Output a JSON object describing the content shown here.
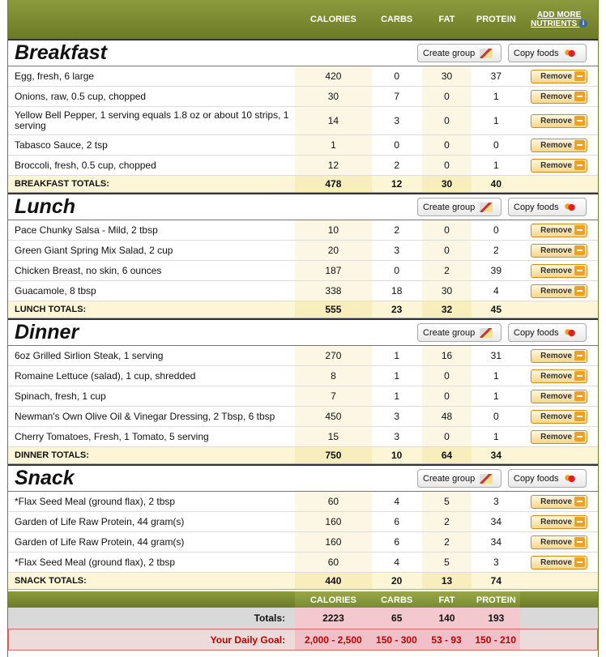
{
  "columns": {
    "calories": "CALORIES",
    "carbs": "CARBS",
    "fat": "FAT",
    "protein": "PROTEIN",
    "add_more_line1": "ADD MORE",
    "add_more_line2": "NUTRIENTS",
    "info_glyph": "i"
  },
  "buttons": {
    "create_group": "Create group",
    "copy_foods": "Copy foods",
    "remove": "Remove"
  },
  "meals": [
    {
      "title": "Breakfast",
      "items": [
        {
          "name": "Egg, fresh, 6 large",
          "calories": "420",
          "carbs": "0",
          "fat": "30",
          "protein": "37"
        },
        {
          "name": "Onions, raw, 0.5 cup, chopped",
          "calories": "30",
          "carbs": "7",
          "fat": "0",
          "protein": "1"
        },
        {
          "name": "Yellow Bell Pepper, 1 serving equals 1.8 oz or about 10 strips, 1 serving",
          "calories": "14",
          "carbs": "3",
          "fat": "0",
          "protein": "1",
          "tall": true
        },
        {
          "name": "Tabasco Sauce, 2 tsp",
          "calories": "1",
          "carbs": "0",
          "fat": "0",
          "protein": "0"
        },
        {
          "name": "Broccoli, fresh, 0.5 cup, chopped",
          "calories": "12",
          "carbs": "2",
          "fat": "0",
          "protein": "1"
        }
      ],
      "totals": {
        "label": "BREAKFAST TOTALS:",
        "calories": "478",
        "carbs": "12",
        "fat": "30",
        "protein": "40"
      }
    },
    {
      "title": "Lunch",
      "items": [
        {
          "name": "Pace Chunky Salsa - Mild, 2 tbsp",
          "calories": "10",
          "carbs": "2",
          "fat": "0",
          "protein": "0"
        },
        {
          "name": "Green Giant Spring Mix Salad, 2 cup",
          "calories": "20",
          "carbs": "3",
          "fat": "0",
          "protein": "2"
        },
        {
          "name": "Chicken Breast, no skin, 6 ounces",
          "calories": "187",
          "carbs": "0",
          "fat": "2",
          "protein": "39"
        },
        {
          "name": "Guacamole, 8 tbsp",
          "calories": "338",
          "carbs": "18",
          "fat": "30",
          "protein": "4"
        }
      ],
      "totals": {
        "label": "LUNCH TOTALS:",
        "calories": "555",
        "carbs": "23",
        "fat": "32",
        "protein": "45"
      }
    },
    {
      "title": "Dinner",
      "items": [
        {
          "name": "6oz Grilled Sirlion Steak, 1 serving",
          "calories": "270",
          "carbs": "1",
          "fat": "16",
          "protein": "31"
        },
        {
          "name": "Romaine Lettuce (salad), 1 cup, shredded",
          "calories": "8",
          "carbs": "1",
          "fat": "0",
          "protein": "1"
        },
        {
          "name": "Spinach, fresh, 1 cup",
          "calories": "7",
          "carbs": "1",
          "fat": "0",
          "protein": "1"
        },
        {
          "name": "Newman's Own Olive Oil & Vinegar Dressing, 2 Tbsp, 6 tbsp",
          "calories": "450",
          "carbs": "3",
          "fat": "48",
          "protein": "0"
        },
        {
          "name": "Cherry Tomatoes, Fresh, 1 Tomato, 5 serving",
          "calories": "15",
          "carbs": "3",
          "fat": "0",
          "protein": "1"
        }
      ],
      "totals": {
        "label": "DINNER TOTALS:",
        "calories": "750",
        "carbs": "10",
        "fat": "64",
        "protein": "34"
      }
    },
    {
      "title": "Snack",
      "items": [
        {
          "name": "*Flax Seed Meal (ground flax), 2 tbsp",
          "calories": "60",
          "carbs": "4",
          "fat": "5",
          "protein": "3"
        },
        {
          "name": "Garden of Life Raw Protein, 44 gram(s)",
          "calories": "160",
          "carbs": "6",
          "fat": "2",
          "protein": "34"
        },
        {
          "name": "Garden of Life Raw Protein, 44 gram(s)",
          "calories": "160",
          "carbs": "6",
          "fat": "2",
          "protein": "34"
        },
        {
          "name": "*Flax Seed Meal (ground flax), 2 tbsp",
          "calories": "60",
          "carbs": "4",
          "fat": "5",
          "protein": "3"
        }
      ],
      "totals": {
        "label": "SNACK TOTALS:",
        "calories": "440",
        "carbs": "20",
        "fat": "13",
        "protein": "74"
      }
    }
  ],
  "footer": {
    "totals_label": "Totals:",
    "totals": {
      "calories": "2223",
      "carbs": "65",
      "fat": "140",
      "protein": "193"
    },
    "goal_label": "Your Daily Goal:",
    "goal": {
      "calories": "2,000 - 2,500",
      "carbs": "150 - 300",
      "fat": "53 - 93",
      "protein": "150 - 210"
    }
  },
  "colors": {
    "header_green": "#7a8a2f",
    "total_bg": "#fdf6d6",
    "goal_red": "#bb0000",
    "remove_orange": "#f0a020"
  }
}
